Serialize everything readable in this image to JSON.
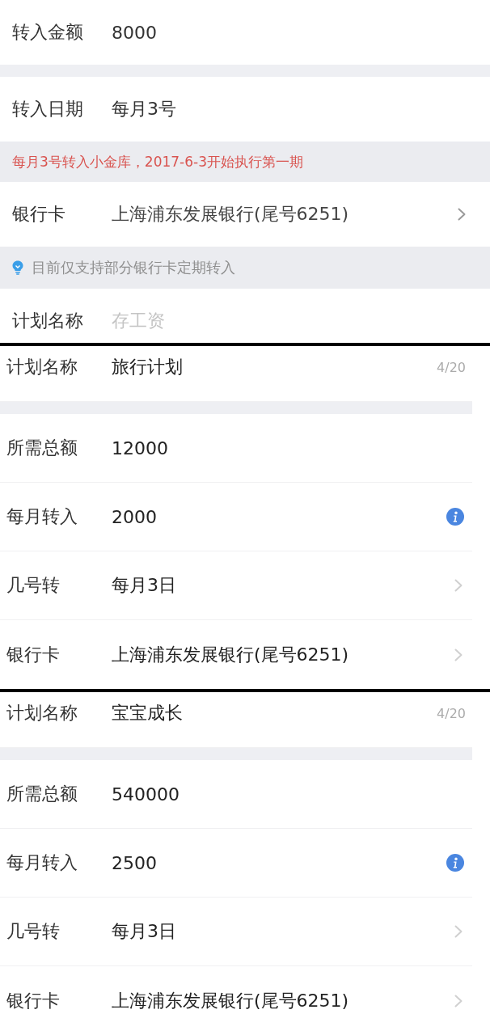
{
  "panels": [
    {
      "kind": "transfer",
      "rows": [
        {
          "kind": "input",
          "label": "转入金额",
          "value": "8000"
        },
        {
          "kind": "gap"
        },
        {
          "kind": "input",
          "label": "转入日期",
          "value": "每月3号"
        },
        {
          "kind": "note",
          "text": "每月3号转入小金库，2017-6-3开始执行第一期"
        },
        {
          "kind": "select",
          "label": "银行卡",
          "value": "上海浦东发展银行(尾号6251)"
        },
        {
          "kind": "tip",
          "text": "目前仅支持部分银行卡定期转入"
        },
        {
          "kind": "input",
          "label": "计划名称",
          "placeholder": "存工资"
        }
      ]
    },
    {
      "kind": "plan",
      "rows": [
        {
          "kind": "input",
          "label": "计划名称",
          "value": "旅行计划",
          "counter": "4/20"
        },
        {
          "kind": "gap"
        },
        {
          "kind": "input",
          "label": "所需总额",
          "value": "12000"
        },
        {
          "kind": "info",
          "label": "每月转入",
          "value": "2000"
        },
        {
          "kind": "select",
          "label": "几号转",
          "value": "每月3日"
        },
        {
          "kind": "select",
          "label": "银行卡",
          "value": "上海浦东发展银行(尾号6251)"
        }
      ]
    },
    {
      "kind": "plan",
      "rows": [
        {
          "kind": "input",
          "label": "计划名称",
          "value": "宝宝成长",
          "counter": "4/20"
        },
        {
          "kind": "gap"
        },
        {
          "kind": "input",
          "label": "所需总额",
          "value": "540000"
        },
        {
          "kind": "info",
          "label": "每月转入",
          "value": "2500"
        },
        {
          "kind": "select",
          "label": "几号转",
          "value": "每月3日"
        },
        {
          "kind": "select",
          "label": "银行卡",
          "value": "上海浦东发展银行(尾号6251)"
        }
      ]
    }
  ]
}
